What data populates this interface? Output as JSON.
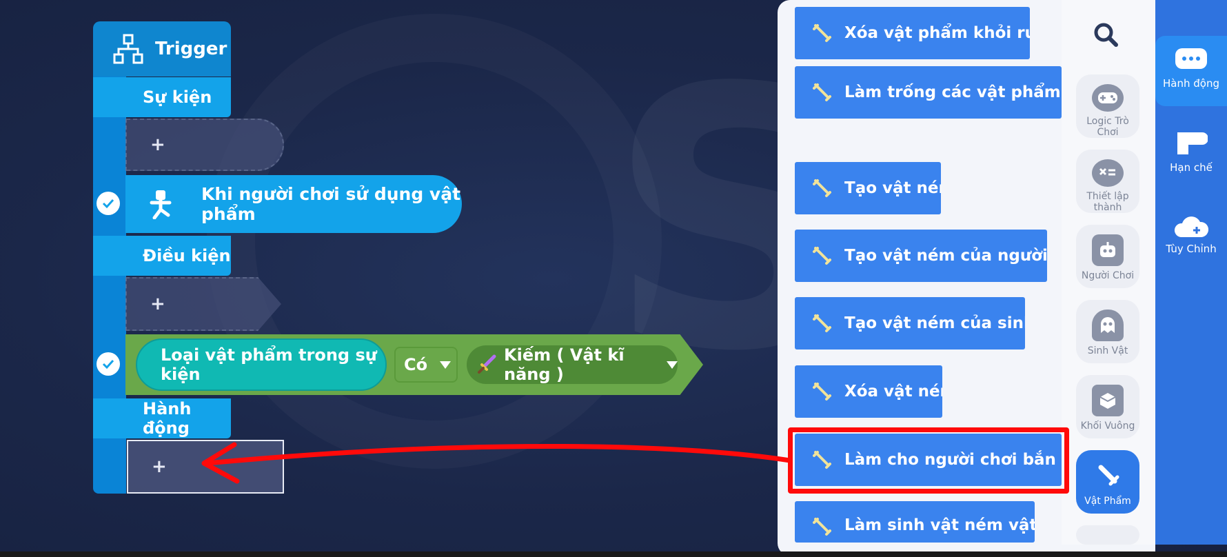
{
  "trigger": {
    "title": "Trigger",
    "sections": {
      "events": "Sự kiện",
      "conditions": "Điều kiện",
      "actions": "Hành động"
    },
    "add_symbol": "+",
    "event_block": "Khi người chơi sử dụng vật phẩm",
    "condition": {
      "subject": "Loại vật phẩm trong sự kiện",
      "operator": "Có",
      "value": "Kiếm ( Vật kĩ năng )"
    }
  },
  "palette": {
    "actions": [
      "Xóa vật phẩm khỏi rương",
      "Làm trống các vật phẩm trong rương",
      "Tạo vật ném",
      "Tạo vật ném của người chơi",
      "Tạo vật ném của sinh vật",
      "Xóa vật ném",
      "Làm cho người chơi bắn vật ném",
      "Làm sinh vật ném vật ném"
    ],
    "categories": [
      "Logic Trò Chơi",
      "Thiết lập thành",
      "Người Chơi",
      "Sinh Vật",
      "Khối Vuông",
      "Vật Phẩm"
    ]
  },
  "tabs": [
    "Hành động",
    "Hạn chế",
    "Tùy Chỉnh"
  ],
  "colors": {
    "trigger_blue": "#13a3ea",
    "condition_green": "#6aa84a",
    "action_button": "#3a83ee",
    "highlight": "#ff0a0a"
  }
}
